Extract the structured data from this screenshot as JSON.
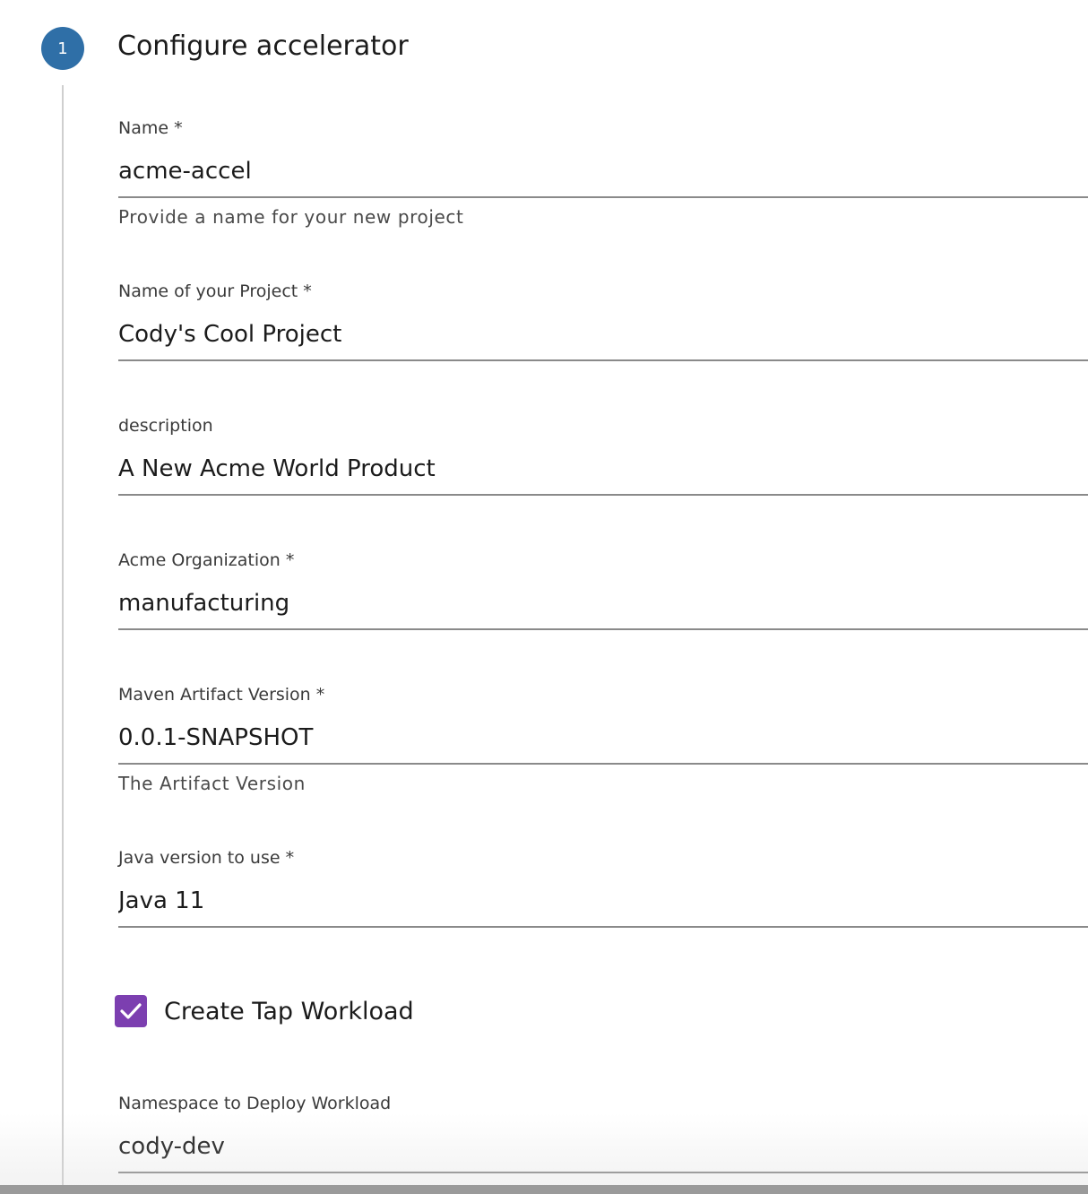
{
  "step": {
    "number": "1",
    "title": "Configure accelerator"
  },
  "fields": [
    {
      "label": "Name *",
      "value": "acme-accel",
      "helper": "Provide a name for your new project"
    },
    {
      "label": "Name of your Project *",
      "value": "Cody's Cool Project"
    },
    {
      "label": "description",
      "value": "A New Acme World Product"
    },
    {
      "label": "Acme Organization *",
      "value": "manufacturing"
    },
    {
      "label": "Maven Artifact Version *",
      "value": "0.0.1-SNAPSHOT",
      "helper": "The Artifact Version"
    },
    {
      "label": "Java version to use *",
      "value": "Java 11"
    }
  ],
  "checkbox": {
    "label": "Create Tap Workload",
    "checked": true,
    "icon": "checkmark-icon",
    "color": "#7c3fb0"
  },
  "namespace_field": {
    "label": "Namespace to Deploy Workload",
    "value": "cody-dev"
  },
  "colors": {
    "step_badge": "#2f6fa7",
    "checkbox": "#7c3fb0"
  }
}
